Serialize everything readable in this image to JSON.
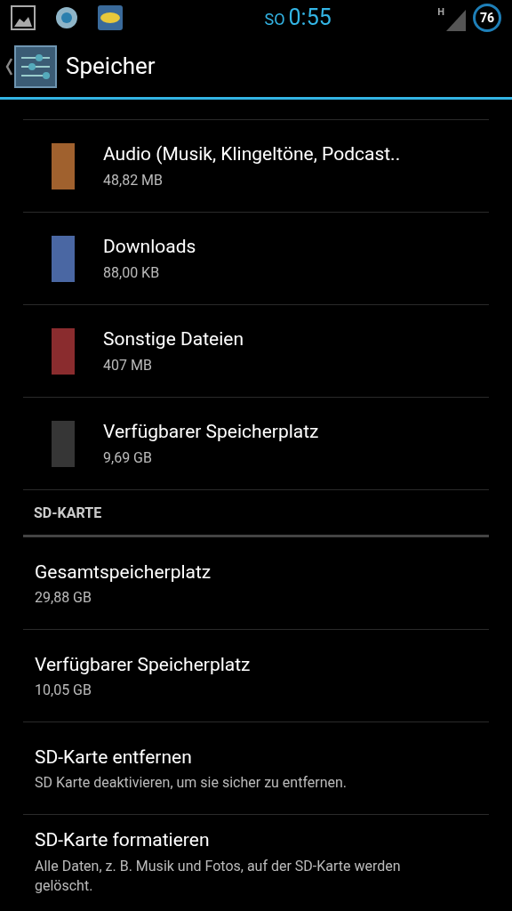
{
  "status_bar": {
    "day": "SO",
    "time": "0:55",
    "network": "H",
    "battery": "76"
  },
  "action_bar": {
    "title": "Speicher"
  },
  "storage_items": [
    {
      "title": "Audio (Musik, Klingeltöne, Podcast..",
      "value": "48,82 MB",
      "color": "#a0612e"
    },
    {
      "title": "Downloads",
      "value": "88,00 KB",
      "color": "#4a67a3"
    },
    {
      "title": "Sonstige Dateien",
      "value": "407 MB",
      "color": "#8a2c2e"
    },
    {
      "title": "Verfügbarer Speicherplatz",
      "value": "9,69 GB",
      "color": "#363636"
    }
  ],
  "sd_section": {
    "header": "SD-KARTE",
    "items": [
      {
        "title": "Gesamtspeicherplatz",
        "summary": "29,88 GB"
      },
      {
        "title": "Verfügbarer Speicherplatz",
        "summary": "10,05 GB"
      },
      {
        "title": "SD-Karte entfernen",
        "summary": "SD Karte deaktivieren, um sie sicher zu entfernen."
      },
      {
        "title": "SD-Karte formatieren",
        "summary": "Alle Daten, z. B. Musik und Fotos, auf der SD-Karte werden gelöscht."
      }
    ]
  }
}
